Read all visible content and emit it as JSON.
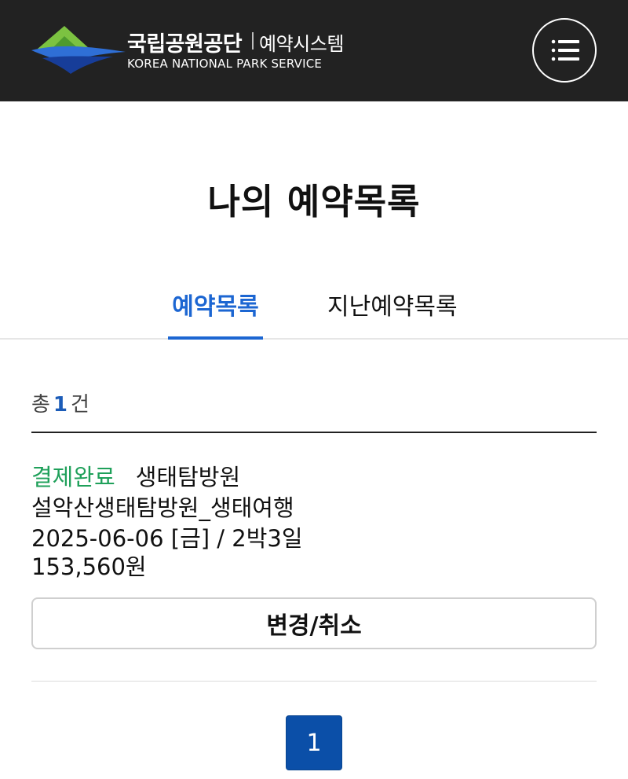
{
  "header": {
    "org_name": "국립공원공단",
    "system_name": "예약시스템",
    "org_name_en": "KOREA NATIONAL PARK SERVICE",
    "menu_icon": "hamburger-menu-icon",
    "background": "#222222"
  },
  "page": {
    "title": "나의 예약목록"
  },
  "tabs": [
    {
      "label": "예약목록",
      "active": true
    },
    {
      "label": "지난예약목록",
      "active": false
    }
  ],
  "summary": {
    "prefix": "총",
    "count": "1",
    "suffix": "건"
  },
  "reservations": [
    {
      "status": "결제완료",
      "category": "생태탐방원",
      "program": "설악산생태탐방원_생태여행",
      "schedule": "2025-06-06 [금] / 2박3일",
      "price": "153,560원",
      "action_label": "변경/취소"
    }
  ],
  "pagination": {
    "current": "1"
  },
  "colors": {
    "accent": "#1c66d2",
    "status_paid": "#1fa05a",
    "pagination_active": "#0b4fa8"
  }
}
